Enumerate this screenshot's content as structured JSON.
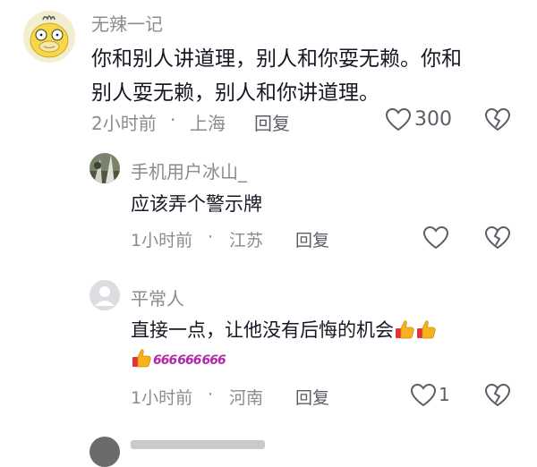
{
  "comments": [
    {
      "username": "无辣一记",
      "text_lines": [
        "你和别人讲道理，别人和你耍无赖。你和",
        "别人耍无赖，别人和你讲道理。"
      ],
      "time": "2小时前",
      "location": "上海",
      "reply_label": "回复",
      "like_count": "300"
    },
    {
      "username": "手机用户冰山_",
      "text": "应该弄个警示牌",
      "time": "1小时前",
      "location": "江苏",
      "reply_label": "回复"
    },
    {
      "username": "平常人",
      "text": "直接一点，让他没有后悔的机会",
      "sixes": [
        "666",
        "666",
        "666"
      ],
      "time": "1小时前",
      "location": "河南",
      "reply_label": "回复",
      "like_count": "1"
    }
  ],
  "separator": "·",
  "colors": {
    "text": "#161823",
    "meta": "#8a8b91",
    "icon": "#5c5e66",
    "six": "#b02aa8"
  },
  "icons": {
    "like": "heart-outline-icon",
    "dislike": "broken-heart-icon"
  }
}
